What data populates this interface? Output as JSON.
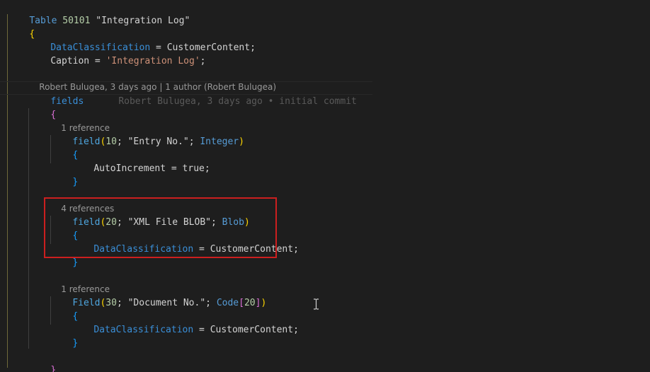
{
  "colors": {
    "background": "#1e1e1e",
    "keyword": "#569cd6",
    "string": "#ce9178",
    "bracket_yellow": "#ffd700",
    "bracket_purple": "#da70d6",
    "bracket_blue": "#179fff",
    "highlight_border": "#cc1f1f",
    "codelens": "#999999",
    "blame": "#5a5a5a"
  },
  "code": {
    "table_keyword": "Table",
    "table_id": "50101",
    "table_name": "\"Integration Log\"",
    "open_brace": "{",
    "close_brace": "}",
    "data_classification": "DataClassification",
    "equals": " = ",
    "customer_content": "CustomerContent;",
    "caption_prop": "Caption",
    "caption_value": "'Integration Log'",
    "semicolon": ";",
    "fields_keyword": "fields",
    "blame_inline": "Robert Bulugea, 3 days ago • initial commit",
    "lens_blame": "Robert Bulugea, 3 days ago | 1 author (Robert Bulugea)",
    "field1": {
      "lens": "1 reference",
      "keyword": "field",
      "args_open": "(",
      "number": "10",
      "sep": "; ",
      "name": "\"Entry No.\"",
      "type": "Integer",
      "args_close": ")",
      "prop": "AutoIncrement",
      "value": "true;"
    },
    "field2": {
      "lens": "4 references",
      "keyword": "field",
      "args_open": "(",
      "number": "20",
      "sep": "; ",
      "name": "\"XML File BLOB\"",
      "type": "Blob",
      "args_close": ")"
    },
    "field3": {
      "lens": "1 reference",
      "keyword": "Field",
      "args_open": "(",
      "number": "30",
      "sep": "; ",
      "name": "\"Document No.\"",
      "type": "Code",
      "type_open": "[",
      "type_len": "20",
      "type_close": "]",
      "args_close": ")"
    }
  }
}
